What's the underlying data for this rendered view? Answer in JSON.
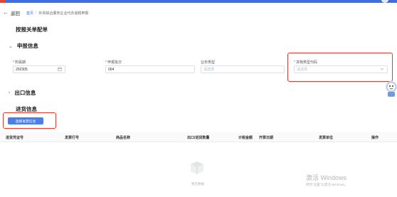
{
  "header": {
    "back_label": "返回",
    "breadcrumb": {
      "home": "首页",
      "separator": "/",
      "current": "外贸综合服务企业代办退税申报"
    }
  },
  "page_title": "按报关单配单",
  "sections": {
    "declare_info": "申报信息",
    "export_info": "出口信息",
    "import_info": "进货信息"
  },
  "form": {
    "period": {
      "label": "所属期",
      "value": "202305",
      "required": true
    },
    "batch": {
      "label": "申报批次",
      "value": "004",
      "required": true
    },
    "business_type": {
      "label": "业务类型",
      "placeholder": "请选择",
      "required": false
    },
    "goods_type_code": {
      "label": "货物类型代码",
      "placeholder": "请选择",
      "required": true
    }
  },
  "select_invoice_button": "选择发票信息",
  "table": {
    "columns": [
      "进货凭证号",
      "发票行号",
      "商品名称",
      "出口/进货数量",
      "计税金额",
      "开票日期",
      "发票单位",
      "操作"
    ],
    "empty_text": "暂无数据"
  },
  "watermark": {
    "title": "激活 Windows",
    "subtitle": "转到\"设置\"以激活 Windows。"
  },
  "colors": {
    "primary": "#4a7fe8",
    "highlight": "#e4392b",
    "required": "#e0462f"
  },
  "icons": {
    "back": "arrow-left-icon",
    "calendar": "calendar-icon",
    "select": "chevron-down-icon",
    "section_expanded": "chevron-down-icon",
    "section_collapsed": "chevron-right-icon",
    "empty": "empty-box-icon"
  }
}
